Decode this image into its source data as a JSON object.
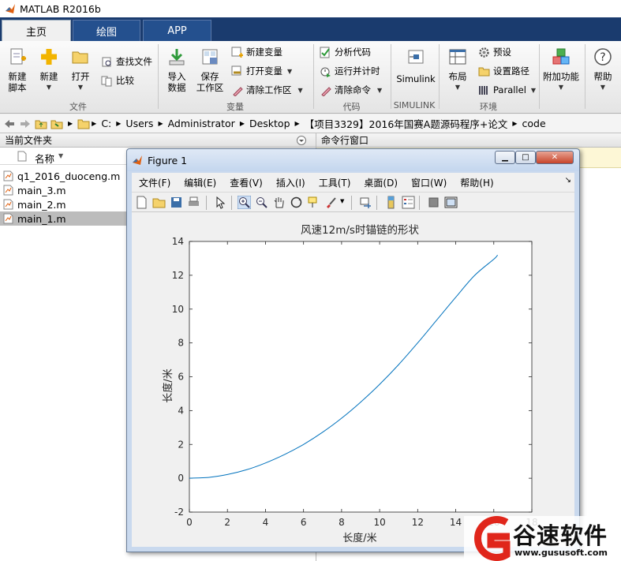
{
  "app": {
    "title": "MATLAB R2016b"
  },
  "tabs": [
    {
      "label": "主页"
    },
    {
      "label": "绘图"
    },
    {
      "label": "APP"
    }
  ],
  "ribbon": {
    "new_script": "新建\n脚本",
    "new_script_l1": "新建",
    "new_script_l2": "脚本",
    "new": "新建",
    "open": "打开",
    "find_files": "查找文件",
    "compare": "比较",
    "import_l1": "导入",
    "import_l2": "数据",
    "save_ws_l1": "保存",
    "save_ws_l2": "工作区",
    "new_var": "新建变量",
    "open_var": "打开变量",
    "clear_ws": "清除工作区",
    "analyze_code": "分析代码",
    "run_time": "运行并计时",
    "clear_cmd": "清除命令",
    "simulink": "Simulink",
    "layout": "布局",
    "preferences": "预设",
    "set_path": "设置路径",
    "parallel": "Parallel",
    "addons": "附加功能",
    "help": "帮助",
    "groups": {
      "file": "文件",
      "variable": "变量",
      "code": "代码",
      "simulink": "SIMULINK",
      "environment": "环境"
    }
  },
  "address": {
    "crumbs": [
      "C:",
      "Users",
      "Administrator",
      "Desktop",
      "【项目3329】2016年国赛A题源码程序+论文",
      "code"
    ]
  },
  "panels": {
    "current_folder": "当前文件夹",
    "command_window": "命令行窗口",
    "name_column": "名称"
  },
  "files": [
    {
      "name": "q1_2016_duoceng.m"
    },
    {
      "name": "main_3.m"
    },
    {
      "name": "main_2.m"
    },
    {
      "name": "main_1.m"
    }
  ],
  "figure": {
    "title": "Figure 1",
    "menu": [
      "文件(F)",
      "编辑(E)",
      "查看(V)",
      "插入(I)",
      "工具(T)",
      "桌面(D)",
      "窗口(W)",
      "帮助(H)"
    ]
  },
  "chart_data": {
    "type": "line",
    "title": "风速12m/s时锚链的形状",
    "xlabel": "长度/米",
    "ylabel": "长度/米",
    "xlim": [
      0,
      18
    ],
    "ylim": [
      -2,
      14
    ],
    "xticks": [
      0,
      2,
      4,
      6,
      8,
      10,
      12,
      14,
      16,
      18
    ],
    "yticks": [
      -2,
      0,
      2,
      4,
      6,
      8,
      10,
      12,
      14
    ],
    "grid": false,
    "series": [
      {
        "color": "#0072bd",
        "x": [
          0,
          1,
          2,
          3,
          4,
          5,
          6,
          7,
          8,
          9,
          10,
          11,
          12,
          13,
          14,
          15,
          16,
          16.2
        ],
        "y": [
          0,
          0.05,
          0.22,
          0.5,
          0.9,
          1.4,
          2.0,
          2.72,
          3.55,
          4.5,
          5.55,
          6.72,
          8.0,
          9.35,
          10.7,
          12.0,
          12.95,
          13.2
        ]
      }
    ]
  },
  "watermark": {
    "text": "谷速软件",
    "url": "www.gususoft.com"
  }
}
